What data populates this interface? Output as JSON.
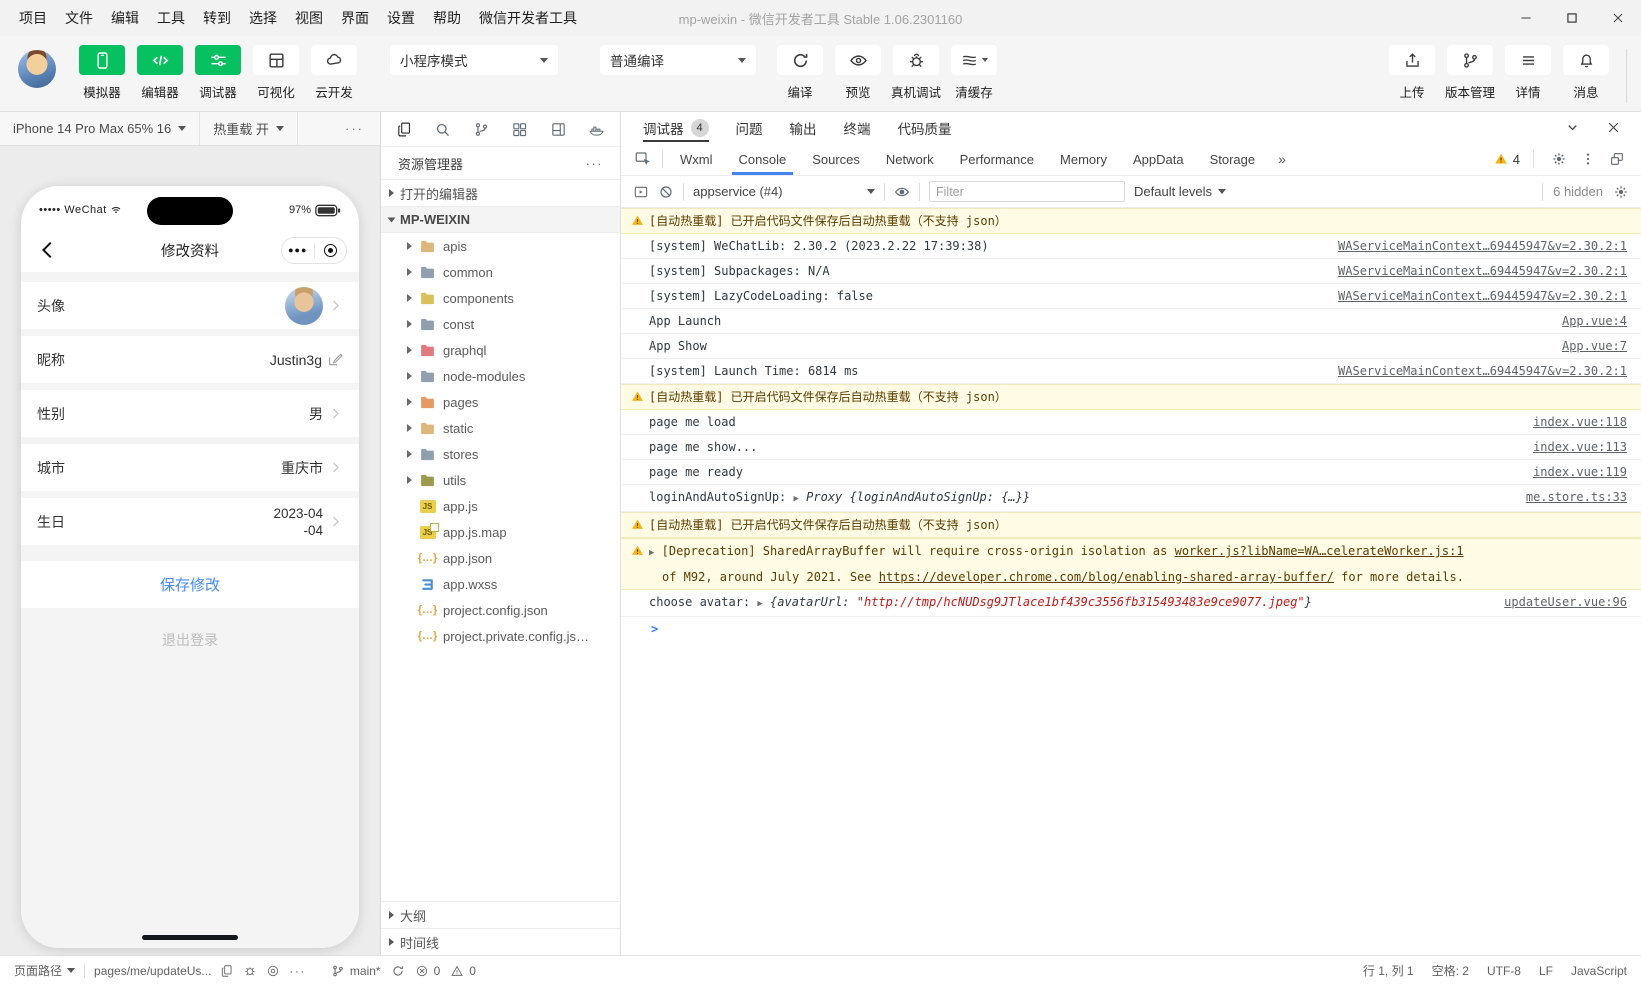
{
  "colors": {
    "accent_green": "#07c160",
    "devtools_active_blue": "#4285f4",
    "warn_bg": "#fffbe5",
    "warn_text": "#5c3c00",
    "string_red": "#c41a16",
    "save_link_blue": "#4589f5"
  },
  "titlebar": {
    "menus": [
      "项目",
      "文件",
      "编辑",
      "工具",
      "转到",
      "选择",
      "视图",
      "界面",
      "设置",
      "帮助",
      "微信开发者工具"
    ],
    "title": "mp-weixin - 微信开发者工具 Stable 1.06.2301160",
    "window_controls": [
      "minimize",
      "maximize",
      "close"
    ]
  },
  "toolbar": {
    "mode_buttons": [
      {
        "label": "模拟器",
        "icon": "phone-icon",
        "active": true
      },
      {
        "label": "编辑器",
        "icon": "code-icon",
        "active": true
      },
      {
        "label": "调试器",
        "icon": "tune-icon",
        "active": true
      },
      {
        "label": "可视化",
        "icon": "grid-icon",
        "active": false
      },
      {
        "label": "云开发",
        "icon": "cloud-icon",
        "active": false
      }
    ],
    "mode_select": "小程序模式",
    "compile_select": "普通编译",
    "action_buttons": [
      {
        "label": "编译",
        "icon": "refresh-icon"
      },
      {
        "label": "预览",
        "icon": "eye-icon"
      },
      {
        "label": "真机调试",
        "icon": "bug-icon"
      },
      {
        "label": "清缓存",
        "icon": "layers-icon",
        "has_caret": true
      }
    ],
    "right_buttons": [
      {
        "label": "上传",
        "icon": "upload-icon"
      },
      {
        "label": "版本管理",
        "icon": "branch-icon"
      },
      {
        "label": "详情",
        "icon": "hamburger-icon"
      },
      {
        "label": "消息",
        "icon": "bell-icon"
      }
    ]
  },
  "simulator": {
    "device": "iPhone 14 Pro Max 65% 16",
    "hot_reload": "热重载 开",
    "more": "···",
    "phone": {
      "carrier": "••••• WeChat",
      "battery": "97%",
      "nav_title": "修改资料",
      "rows": [
        {
          "label": "头像",
          "value": "",
          "type": "avatar"
        },
        {
          "label": "昵称",
          "value": "Justin3g",
          "type": "edit"
        },
        {
          "label": "性别",
          "value": "男",
          "type": "chevron"
        },
        {
          "label": "城市",
          "value": "重庆市",
          "type": "chevron"
        },
        {
          "label": "生日",
          "value": "2023-04-04",
          "type": "chevron-wrap"
        }
      ],
      "save_button": "保存修改",
      "logout_button": "退出登录"
    }
  },
  "explorer": {
    "activity_icons": [
      "files-icon",
      "search-icon",
      "git-icon",
      "blocks-icon",
      "layout-icon",
      "docker-icon"
    ],
    "title": "资源管理器",
    "more": "···",
    "open_editors": "打开的编辑器",
    "root": "MP-WEIXIN",
    "tree": [
      {
        "name": "apis",
        "kind": "folder",
        "color": "#dcb67a"
      },
      {
        "name": "common",
        "kind": "folder",
        "color": "#8f9fae"
      },
      {
        "name": "components",
        "kind": "folder",
        "color": "#d9c05a"
      },
      {
        "name": "const",
        "kind": "folder",
        "color": "#8f9fae"
      },
      {
        "name": "graphql",
        "kind": "folder",
        "color": "#df7a80"
      },
      {
        "name": "node-modules",
        "kind": "folder",
        "color": "#8f9fae"
      },
      {
        "name": "pages",
        "kind": "folder",
        "color": "#e59a63"
      },
      {
        "name": "static",
        "kind": "folder",
        "color": "#dcb67a"
      },
      {
        "name": "stores",
        "kind": "folder",
        "color": "#8f9fae"
      },
      {
        "name": "utils",
        "kind": "folder",
        "color": "#9d9a4e"
      },
      {
        "name": "app.js",
        "kind": "js"
      },
      {
        "name": "app.js.map",
        "kind": "jsmap"
      },
      {
        "name": "app.json",
        "kind": "braces"
      },
      {
        "name": "app.wxss",
        "kind": "wxss"
      },
      {
        "name": "project.config.json",
        "kind": "braces"
      },
      {
        "name": "project.private.config.js…",
        "kind": "braces"
      }
    ],
    "bottom_sections": [
      "大纲",
      "时间线"
    ]
  },
  "debuggerPanel": {
    "tabs": [
      {
        "label": "调试器",
        "badge": "4",
        "active": true
      },
      {
        "label": "问题",
        "active": false
      },
      {
        "label": "输出",
        "active": false
      },
      {
        "label": "终端",
        "active": false
      },
      {
        "label": "代码质量",
        "active": false
      }
    ],
    "devtools_tabs": [
      {
        "label": "Wxml",
        "active": false
      },
      {
        "label": "Console",
        "active": true
      },
      {
        "label": "Sources",
        "active": false
      },
      {
        "label": "Network",
        "active": false
      },
      {
        "label": "Performance",
        "active": false
      },
      {
        "label": "Memory",
        "active": false
      },
      {
        "label": "AppData",
        "active": false
      },
      {
        "label": "Storage",
        "active": false
      }
    ],
    "more_tabs": "»",
    "warning_count": "4",
    "console_toolbar": {
      "context": "appservice (#4)",
      "filter_placeholder": "Filter",
      "levels": "Default levels",
      "hidden": "6 hidden"
    },
    "console_rows": [
      {
        "kind": "warn",
        "segments": [
          {
            "text": "[自动热重载] 已开启代码文件保存后自动热重载（不支持 json）",
            "style": "plain"
          }
        ]
      },
      {
        "kind": "log",
        "segments": [
          {
            "text": "[system] WeChatLib: 2.30.2 (2023.2.22 17:39:38)",
            "style": "plain"
          }
        ],
        "link": "WAServiceMainContext…69445947&v=2.30.2:1"
      },
      {
        "kind": "log",
        "segments": [
          {
            "text": "[system] Subpackages: N/A",
            "style": "plain"
          }
        ],
        "link": "WAServiceMainContext…69445947&v=2.30.2:1"
      },
      {
        "kind": "log",
        "segments": [
          {
            "text": "[system] LazyCodeLoading: false",
            "style": "plain"
          }
        ],
        "link": "WAServiceMainContext…69445947&v=2.30.2:1"
      },
      {
        "kind": "log",
        "segments": [
          {
            "text": "App Launch",
            "style": "plain"
          }
        ],
        "link": "App.vue:4"
      },
      {
        "kind": "log",
        "segments": [
          {
            "text": "App Show",
            "style": "plain"
          }
        ],
        "link": "App.vue:7"
      },
      {
        "kind": "log",
        "segments": [
          {
            "text": "[system] Launch Time: 6814 ms",
            "style": "plain"
          }
        ],
        "link": "WAServiceMainContext…69445947&v=2.30.2:1"
      },
      {
        "kind": "warn",
        "segments": [
          {
            "text": "[自动热重载] 已开启代码文件保存后自动热重载（不支持 json）",
            "style": "plain"
          }
        ]
      },
      {
        "kind": "log",
        "segments": [
          {
            "text": "page me load",
            "style": "plain"
          }
        ],
        "link": "index.vue:118"
      },
      {
        "kind": "log",
        "segments": [
          {
            "text": "page me show...",
            "style": "plain"
          }
        ],
        "link": "index.vue:113"
      },
      {
        "kind": "log",
        "segments": [
          {
            "text": "page me ready",
            "style": "plain"
          }
        ],
        "link": "index.vue:119"
      },
      {
        "kind": "log",
        "segments": [
          {
            "text": "loginAndAutoSignUp: ",
            "style": "plain"
          },
          {
            "text": "▶",
            "style": "caret"
          },
          {
            "text": " Proxy {loginAndAutoSignUp: {…}}",
            "style": "obj"
          }
        ],
        "link": "me.store.ts:33"
      },
      {
        "kind": "warn",
        "segments": [
          {
            "text": "[自动热重载] 已开启代码文件保存后自动热重载（不支持 json）",
            "style": "plain"
          }
        ]
      },
      {
        "kind": "warn",
        "lines": [
          [
            {
              "text": "▶",
              "style": "caret"
            },
            {
              "text": " [Deprecation] SharedArrayBuffer will require cross-origin isolation as ",
              "style": "plain"
            },
            {
              "text": "worker.js?libName=WA…celerateWorker.js:1",
              "style": "wlink"
            }
          ],
          [
            {
              "text": "of M92, around July 2021. See ",
              "style": "plain"
            },
            {
              "text": "https://developer.chrome.com/blog/enabling-shared-array-buffer/",
              "style": "wlink"
            },
            {
              "text": " for more details.",
              "style": "plain"
            }
          ]
        ]
      },
      {
        "kind": "log",
        "segments": [
          {
            "text": "choose avatar: ",
            "style": "plain"
          },
          {
            "text": "▶",
            "style": "caret"
          },
          {
            "text": " {avatarUrl: ",
            "style": "obj"
          },
          {
            "text": "\"http://tmp/hcNUDsg9JTlace1bf439c3556fb315493483e9ce9077.jpeg\"",
            "style": "str"
          },
          {
            "text": "}",
            "style": "obj"
          }
        ],
        "link": "updateUser.vue:96"
      },
      {
        "kind": "prompt",
        "prompt_char": ">"
      }
    ]
  },
  "statusbar": {
    "left_label": "页面路径",
    "path": "pages/me/updateUs...",
    "more": "···",
    "branch": "main*",
    "error_count": "0",
    "warning_count": "0",
    "right_items": [
      "行 1, 列 1",
      "空格: 2",
      "UTF-8",
      "LF",
      "JavaScript"
    ]
  }
}
